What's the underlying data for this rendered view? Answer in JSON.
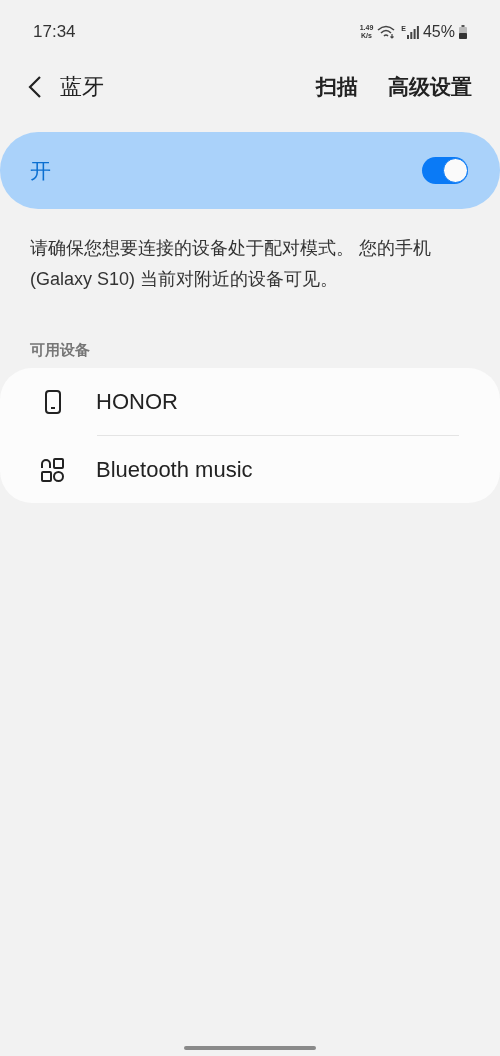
{
  "status_bar": {
    "time": "17:34",
    "speed_value": "1.49",
    "speed_unit": "K/s",
    "network_type": "E",
    "battery": "45%"
  },
  "header": {
    "title": "蓝牙",
    "actions": [
      "扫描",
      "高级设置"
    ]
  },
  "master_switch": {
    "label": "开",
    "on": true
  },
  "description": "请确保您想要连接的设备处于配对模式。 您的手机 (Galaxy S10) 当前对附近的设备可见。",
  "available": {
    "heading": "可用设备",
    "devices": [
      {
        "name": "HONOR",
        "kind": "phone"
      },
      {
        "name": "Bluetooth music",
        "kind": "other"
      }
    ]
  }
}
